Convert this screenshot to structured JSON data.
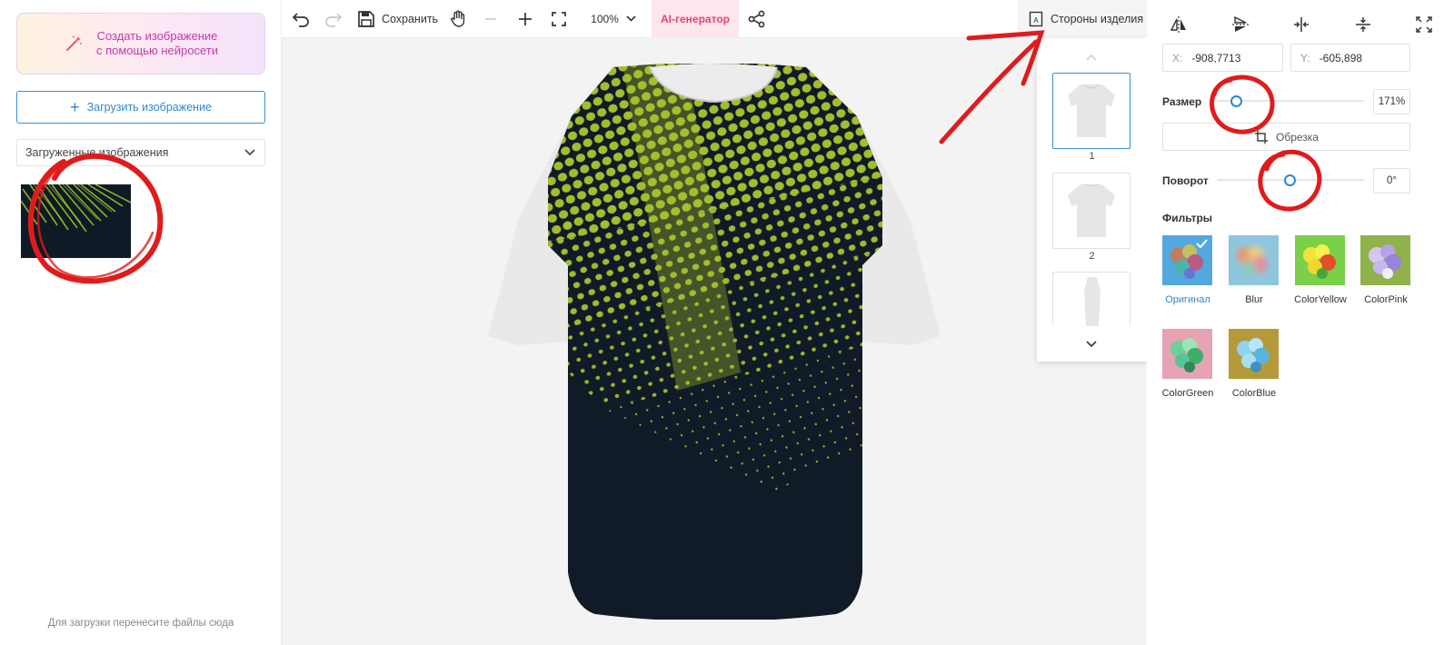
{
  "left_panel": {
    "ai_card_line1": "Создать изображение",
    "ai_card_line2": "с помощью нейросети",
    "upload_button": "Загрузить изображение",
    "uploaded_dropdown": "Загруженные изображения",
    "drop_hint": "Для загрузки перенесите файлы сюда"
  },
  "toolbar": {
    "save_label": "Сохранить",
    "zoom": "100%",
    "ai_tab": "AI-генератор",
    "sides_label": "Стороны изделия",
    "icons": [
      "undo-icon",
      "redo-icon",
      "save-icon",
      "hand-icon",
      "zoom-out-icon",
      "zoom-in-icon",
      "fit-screen-icon",
      "chevron-down-icon",
      "share-icon",
      "sides-icon"
    ]
  },
  "sides_panel": {
    "items": [
      {
        "number": "1",
        "active": true
      },
      {
        "number": "2",
        "active": false
      }
    ]
  },
  "properties": {
    "x_label": "X:",
    "x_value": "-908,7713",
    "y_label": "Y:",
    "y_value": "-605,898",
    "size_label": "Размер",
    "size_value": "171%",
    "crop_label": "Обрезка",
    "rotation_label": "Поворот",
    "rotation_value": "0°",
    "filters_label": "Фильтры",
    "filters": [
      {
        "name": "Оригинал",
        "active": true
      },
      {
        "name": "Blur",
        "active": false
      },
      {
        "name": "ColorYellow",
        "active": false
      },
      {
        "name": "ColorPink",
        "active": false
      },
      {
        "name": "ColorGreen",
        "active": false
      },
      {
        "name": "ColorBlue",
        "active": false
      }
    ]
  },
  "colors": {
    "accent": "#2f86d3",
    "ai_pink": "#e8436e",
    "shirt_print_dark": "#101b27",
    "shirt_print_green": "#a3be2a",
    "annotation_red": "#e11b1b"
  }
}
